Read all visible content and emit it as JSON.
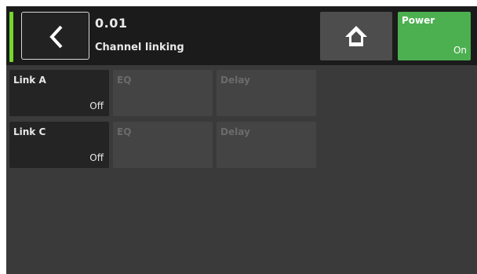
{
  "header": {
    "page_number": "0.01",
    "page_title": "Channel linking",
    "status_color": "#74d62a",
    "back_icon": "chevron-left-icon",
    "home_icon": "home-icon",
    "power": {
      "label": "Power",
      "state": "On",
      "color": "#4caf50"
    }
  },
  "grid": {
    "rows": [
      {
        "link": {
          "label": "Link A",
          "value": "Off"
        },
        "eq": {
          "label": "EQ"
        },
        "delay": {
          "label": "Delay"
        }
      },
      {
        "link": {
          "label": "Link C",
          "value": "Off"
        },
        "eq": {
          "label": "EQ"
        },
        "delay": {
          "label": "Delay"
        }
      }
    ]
  }
}
